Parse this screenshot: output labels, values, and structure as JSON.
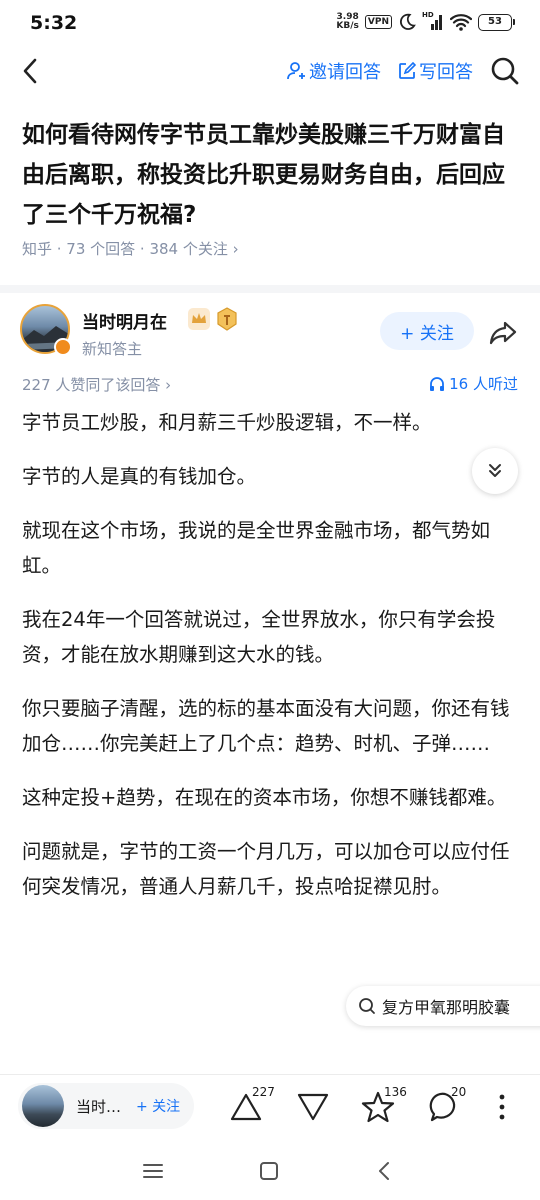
{
  "status_bar": {
    "time": "5:32",
    "net_speed_value": "3.98",
    "net_speed_unit": "KB/s",
    "vpn": "VPN",
    "signal_tag": "HD",
    "battery": "53"
  },
  "nav": {
    "invite_label": "邀请回答",
    "write_label": "写回答",
    "accent_color": "#1772f6"
  },
  "question": {
    "title": "如何看待网传字节员工靠炒美股赚三千万财富自由后离职，称投资比升职更易财务自由，后回应了三个千万祝福?",
    "meta": "知乎 · 73 个回答 · 384 个关注 ›"
  },
  "author": {
    "name": "当时明月在",
    "subtitle": "新知答主",
    "follow_label": "+ 关注"
  },
  "answer": {
    "agree_text": "227 人赞同了该回答 ›",
    "listen_text": "16 人听过",
    "paragraphs": [
      "字节员工炒股，和月薪三千炒股逻辑，不一样。",
      "字节的人是真的有钱加仓。",
      "就现在这个市场，我说的是全世界金融市场，都气势如虹。",
      "我在24年一个回答就说过，全世界放水，你只有学会投资，才能在放水期赚到这大水的钱。",
      "你只要脑子清醒，选的标的基本面没有大问题，你还有钱加仓……你完美赶上了几个点：趋势、时机、子弹……",
      "这种定投+趋势，在现在的资本市场，你想不赚钱都难。",
      "问题就是，字节的工资一个月几万，可以加仓可以应付任何突发情况，普通人月薪几千，投点哈捉襟见肘。"
    ]
  },
  "search_suggest": {
    "text": "复方甲氧那明胶囊"
  },
  "bottom_bar": {
    "mini_name": "当时…",
    "mini_follow": "+ 关注",
    "upvote_count": "227",
    "favorite_count": "136",
    "comment_count": "20"
  }
}
